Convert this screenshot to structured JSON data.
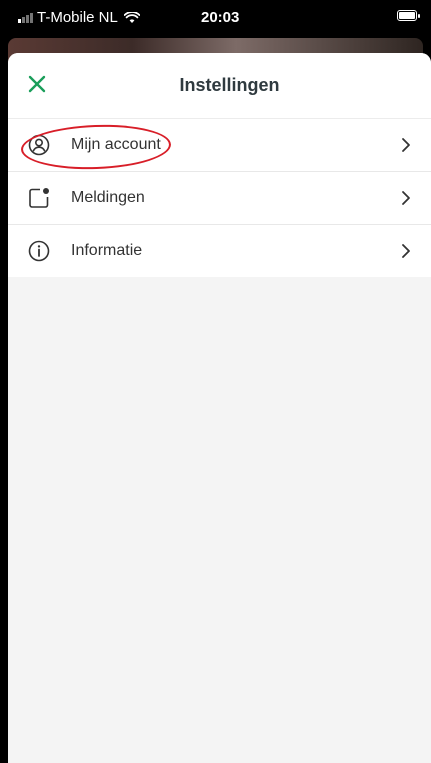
{
  "status_bar": {
    "carrier": "T-Mobile NL",
    "time": "20:03"
  },
  "header": {
    "title": "Instellingen",
    "close_icon": "close-icon",
    "accent_color": "#1a9e5a"
  },
  "settings": {
    "items": [
      {
        "label": "Mijn account",
        "icon": "account-icon",
        "highlighted": true
      },
      {
        "label": "Meldingen",
        "icon": "notification-icon",
        "highlighted": false
      },
      {
        "label": "Informatie",
        "icon": "info-icon",
        "highlighted": false
      }
    ]
  },
  "annotation_color": "#d81e28"
}
